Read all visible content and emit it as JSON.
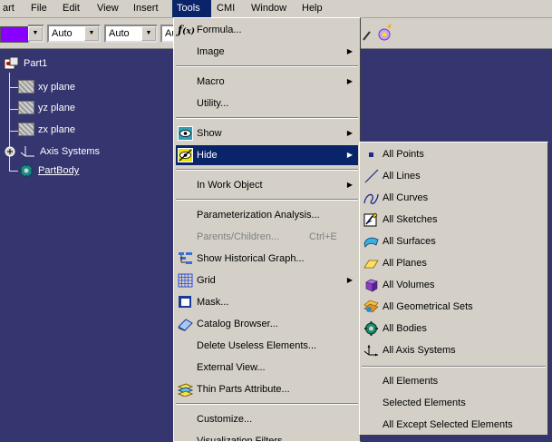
{
  "menubar": {
    "items": [
      {
        "label": "art",
        "mnemonic": ""
      },
      {
        "label": "File",
        "mnemonic": "F"
      },
      {
        "label": "Edit",
        "mnemonic": "E"
      },
      {
        "label": "View",
        "mnemonic": "V"
      },
      {
        "label": "Insert",
        "mnemonic": "I"
      },
      {
        "label": "Tools",
        "mnemonic": "T"
      },
      {
        "label": "CMI",
        "mnemonic": "C"
      },
      {
        "label": "Window",
        "mnemonic": "W"
      },
      {
        "label": "Help",
        "mnemonic": "H"
      }
    ]
  },
  "toolbar": {
    "color": "#8a00ff",
    "dropdowns": [
      "Auto",
      "Auto",
      "Au"
    ]
  },
  "tree": {
    "root": "Part1",
    "items": [
      "xy plane",
      "yz plane",
      "zx plane",
      "Axis Systems",
      "PartBody"
    ]
  },
  "tools_menu": {
    "items": [
      {
        "label": "Formula...",
        "icon": "formula-icon"
      },
      {
        "label": "Image",
        "submenu": true
      },
      {
        "label": "Macro",
        "submenu": true
      },
      {
        "label": "Utility..."
      },
      {
        "label": "Show",
        "icon": "show-icon",
        "submenu": true
      },
      {
        "label": "Hide",
        "icon": "hide-icon",
        "submenu": true,
        "highlighted": true
      },
      {
        "label": "In Work Object",
        "submenu": true
      },
      {
        "label": "Parameterization Analysis..."
      },
      {
        "label": "Parents/Children...",
        "shortcut": "Ctrl+E",
        "disabled": true
      },
      {
        "label": "Show Historical Graph...",
        "icon": "historical-graph-icon"
      },
      {
        "label": "Grid",
        "icon": "grid-icon",
        "submenu": true
      },
      {
        "label": "Mask...",
        "icon": "mask-icon"
      },
      {
        "label": "Catalog Browser...",
        "icon": "catalog-icon"
      },
      {
        "label": "Delete Useless Elements..."
      },
      {
        "label": "External View..."
      },
      {
        "label": "Thin Parts Attribute...",
        "icon": "thin-parts-icon"
      },
      {
        "label": "Customize..."
      },
      {
        "label": "Visualization Filters..."
      }
    ]
  },
  "hide_submenu": {
    "items": [
      {
        "label": "All Points",
        "icon": "point-icon"
      },
      {
        "label": "All Lines",
        "icon": "line-icon"
      },
      {
        "label": "All Curves",
        "icon": "curve-icon"
      },
      {
        "label": "All Sketches",
        "icon": "sketch-icon"
      },
      {
        "label": "All Surfaces",
        "icon": "surface-icon"
      },
      {
        "label": "All Planes",
        "icon": "plane-icon"
      },
      {
        "label": "All Volumes",
        "icon": "volume-icon"
      },
      {
        "label": "All Geometrical Sets",
        "icon": "geometrical-set-icon"
      },
      {
        "label": "All Bodies",
        "icon": "body-icon"
      },
      {
        "label": "All Axis Systems",
        "icon": "axis-system-icon"
      },
      {
        "label": "All Elements"
      },
      {
        "label": "Selected Elements"
      },
      {
        "label": "All Except Selected Elements"
      }
    ]
  }
}
